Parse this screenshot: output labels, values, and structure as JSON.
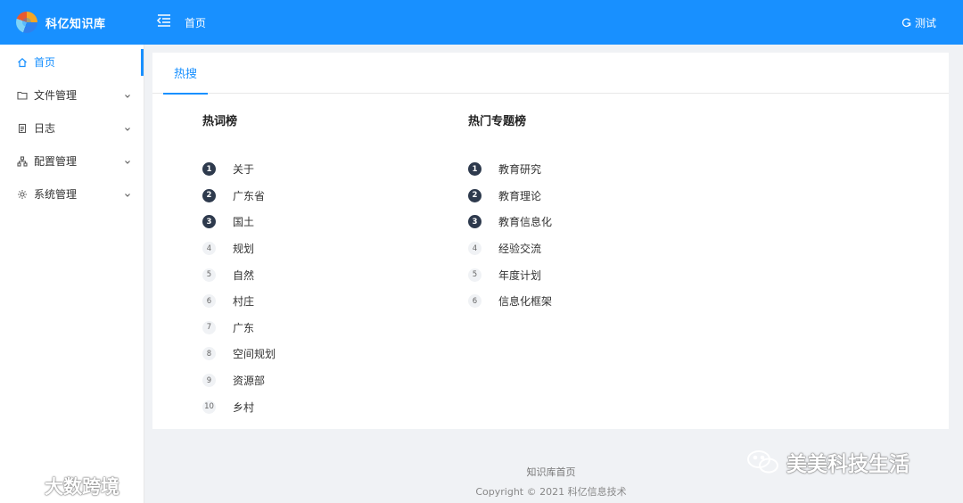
{
  "app": {
    "logo_text": "科亿知识库",
    "breadcrumb": "首页",
    "user": "测试"
  },
  "sidebar": {
    "items": [
      {
        "label": "首页",
        "icon": "home-icon",
        "active": true
      },
      {
        "label": "文件管理",
        "icon": "folder-icon",
        "expandable": true
      },
      {
        "label": "日志",
        "icon": "log-icon",
        "expandable": true
      },
      {
        "label": "配置管理",
        "icon": "sitemap-icon",
        "expandable": true
      },
      {
        "label": "系统管理",
        "icon": "gear-icon",
        "expandable": true
      }
    ]
  },
  "main": {
    "tab": "热搜",
    "hot_words": {
      "title": "热词榜",
      "items": [
        {
          "rank": "1",
          "label": "关于"
        },
        {
          "rank": "2",
          "label": "广东省"
        },
        {
          "rank": "3",
          "label": "国土"
        },
        {
          "rank": "4",
          "label": "规划"
        },
        {
          "rank": "5",
          "label": "自然"
        },
        {
          "rank": "6",
          "label": "村庄"
        },
        {
          "rank": "7",
          "label": "广东"
        },
        {
          "rank": "8",
          "label": "空间规划"
        },
        {
          "rank": "9",
          "label": "资源部"
        },
        {
          "rank": "10",
          "label": "乡村"
        }
      ]
    },
    "hot_topics": {
      "title": "热门专题榜",
      "items": [
        {
          "rank": "1",
          "label": "教育研究"
        },
        {
          "rank": "2",
          "label": "教育理论"
        },
        {
          "rank": "3",
          "label": "教育信息化"
        },
        {
          "rank": "4",
          "label": "经验交流"
        },
        {
          "rank": "5",
          "label": "年度计划"
        },
        {
          "rank": "6",
          "label": "信息化框架"
        }
      ]
    }
  },
  "footer": {
    "link": "知识库首页",
    "copyright": "Copyright © 2021 科亿信息技术"
  },
  "watermarks": {
    "left": "大数跨境",
    "right": "美美科技生活"
  },
  "colors": {
    "primary": "#1890ff",
    "rank_top": "#2e3a4d",
    "rank_plain": "#f0f2f5"
  }
}
